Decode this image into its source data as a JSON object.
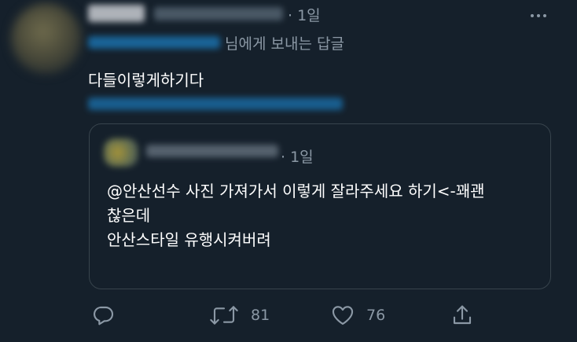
{
  "tweet": {
    "time": "· 1일",
    "reply_suffix": "님에게 보내는 답글",
    "text": "다들이렇게하기다",
    "quote": {
      "time": "· 1일",
      "lines": [
        "@안산선수 사진 가져가서 이렇게 잘라주세요 하기<-꽤괜",
        "찮은데",
        "",
        "안산스타일 유행시켜버려"
      ]
    },
    "actions": {
      "retweet_count": "81",
      "like_count": "76"
    }
  },
  "icons": {
    "more": "more-icon",
    "reply": "reply-icon",
    "retweet": "retweet-icon",
    "like": "heart-icon",
    "share": "share-icon"
  },
  "colors": {
    "background": "#15202b",
    "secondary_text": "#8b98a5",
    "border": "#38444d",
    "link": "#1d9bf0"
  }
}
